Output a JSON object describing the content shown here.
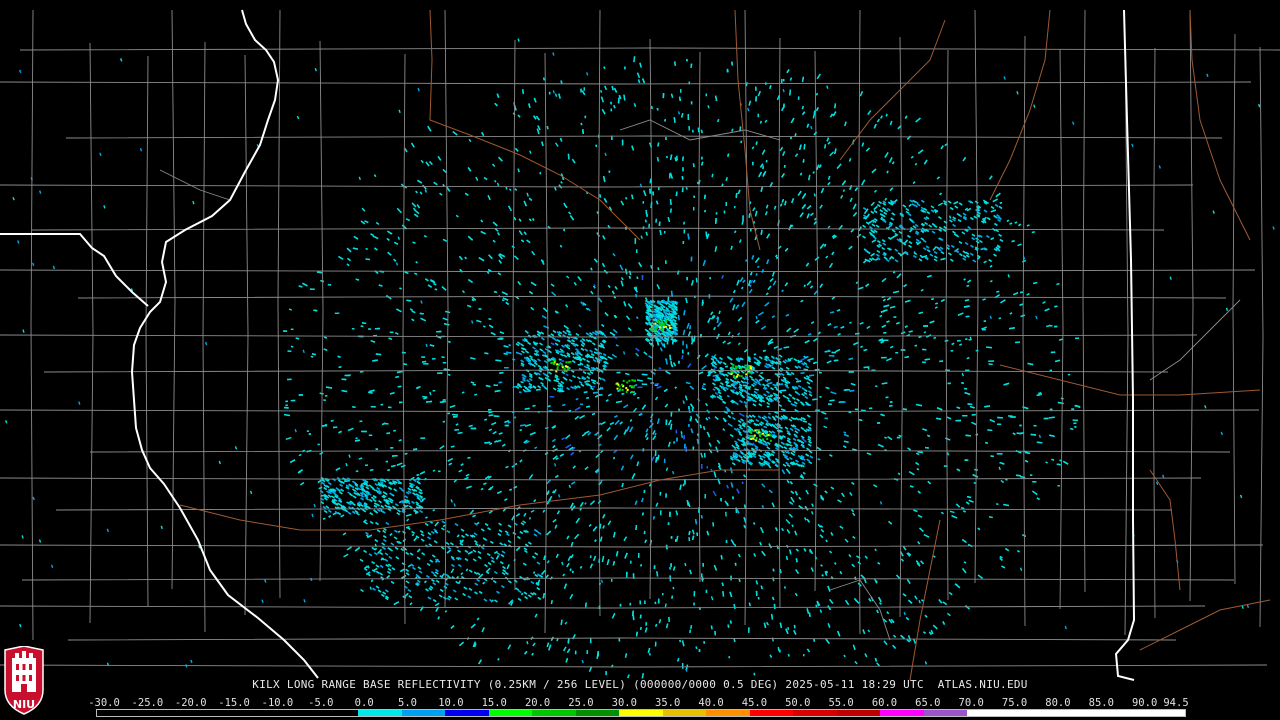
{
  "product": {
    "caption_parts": [
      "KILX",
      "LONG RANGE BASE REFLECTIVITY",
      "(0.25KM / 256 LEVEL)",
      "(000000/0000",
      "0.5 DEG)",
      "2025-05-11 18:29 UTC",
      "ATLAS.NIU.EDU"
    ]
  },
  "color_scale": {
    "labels": [
      "-30.0",
      "-25.0",
      "-20.0",
      "-15.0",
      "-10.0",
      "-5.0",
      "0.0",
      "5.0",
      "10.0",
      "15.0",
      "20.0",
      "25.0",
      "30.0",
      "35.0",
      "40.0",
      "45.0",
      "50.0",
      "55.0",
      "60.0",
      "65.0",
      "70.0",
      "75.0",
      "80.0",
      "85.0",
      "90.0",
      "94.5"
    ],
    "colors": [
      "#000000",
      "#000000",
      "#000000",
      "#000000",
      "#000000",
      "#000000",
      "#00e8e8",
      "#00a0f0",
      "#0000f0",
      "#00ff00",
      "#00c800",
      "#009000",
      "#ffff00",
      "#e8c000",
      "#ff9000",
      "#ff0000",
      "#d60000",
      "#c00000",
      "#ff00ff",
      "#9955c9",
      "#ffffff",
      "#ffffff",
      "#ffffff",
      "#ffffff",
      "#ffffff"
    ]
  },
  "logo": {
    "text": "NIU",
    "brand_color": "#c8102e"
  },
  "map_style": {
    "background": "#000000",
    "county_line": "#8c8c8c",
    "state_line": "#ffffff",
    "road_line": "#a05a32",
    "echo_colors": [
      "#00e0e0",
      "#00a8e8",
      "#1a5ef0",
      "#00d000",
      "#ffff00"
    ]
  }
}
